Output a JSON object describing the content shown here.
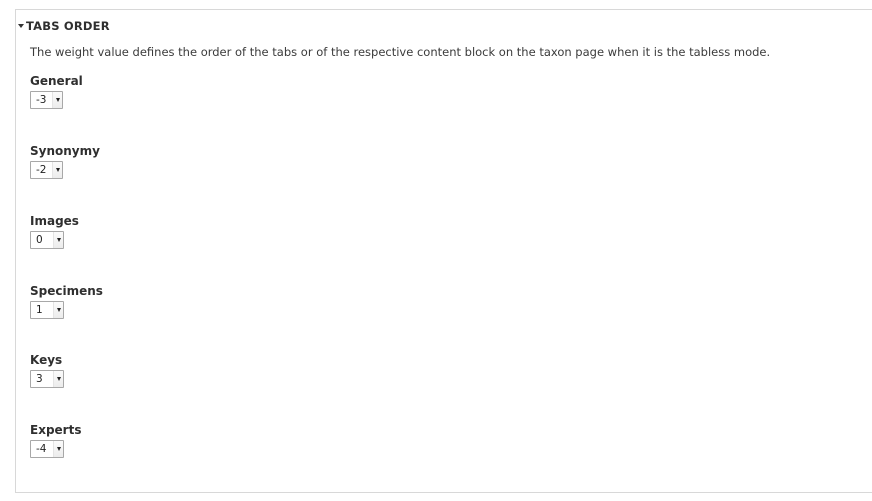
{
  "fieldset": {
    "legend": "TABS ORDER",
    "description": "The weight value defines the order of the tabs or of the respective content block on the taxon page when it is the tabless mode."
  },
  "fields": [
    {
      "label": "General",
      "value": "-3"
    },
    {
      "label": "Synonymy",
      "value": "-2"
    },
    {
      "label": "Images",
      "value": "0"
    },
    {
      "label": "Specimens",
      "value": "1"
    },
    {
      "label": "Keys",
      "value": "3"
    },
    {
      "label": "Experts",
      "value": "-4"
    }
  ]
}
